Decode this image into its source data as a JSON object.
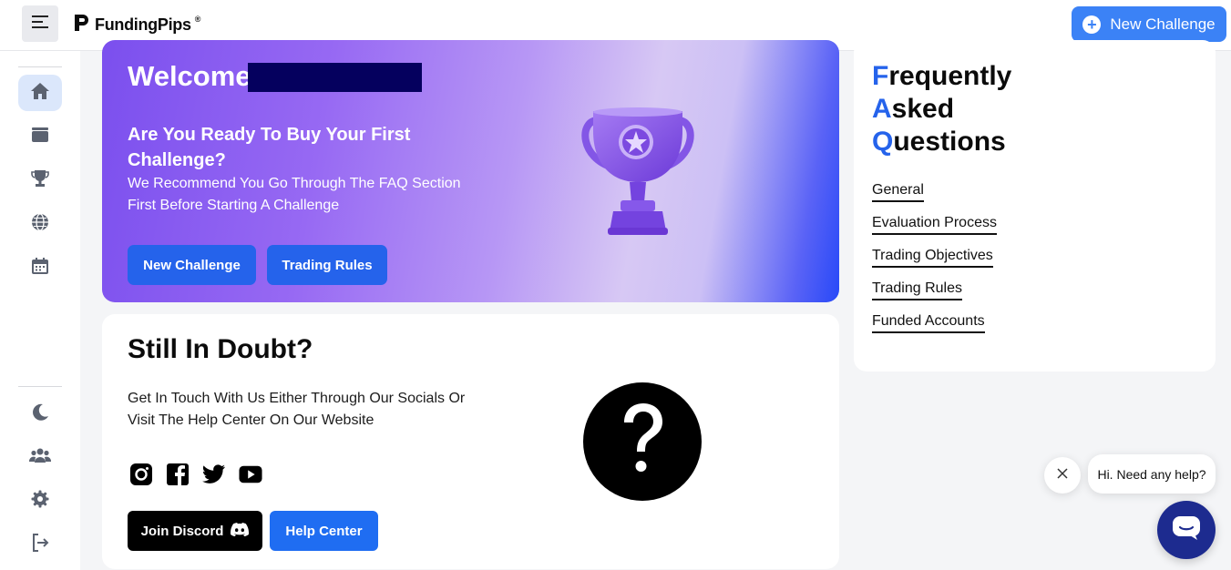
{
  "header": {
    "brand_name": "FundingPips",
    "brand_reg": "®",
    "new_challenge_label": "New Challenge"
  },
  "sidebar": {
    "items": [
      {
        "icon": "home-icon",
        "active": true
      },
      {
        "icon": "wallet-icon"
      },
      {
        "icon": "trophy-icon"
      },
      {
        "icon": "globe-icon"
      },
      {
        "icon": "calendar-icon"
      }
    ],
    "bottom_items": [
      {
        "icon": "moon-icon"
      },
      {
        "icon": "users-icon"
      },
      {
        "icon": "gear-icon"
      },
      {
        "icon": "logout-icon"
      }
    ]
  },
  "hero": {
    "welcome": "Welcome",
    "heading": "Are You Ready To Buy Your First Challenge?",
    "description": "We Recommend You Go Through The FAQ Section First Before Starting A Challenge",
    "new_challenge_label": "New Challenge",
    "trading_rules_label": "Trading Rules"
  },
  "doubt": {
    "heading": "Still In Doubt?",
    "description": "Get In Touch With Us Either Through Our Socials Or Visit The Help Center On Our Website",
    "socials": [
      "instagram-icon",
      "facebook-icon",
      "twitter-icon",
      "youtube-icon"
    ],
    "join_discord_label": "Join Discord",
    "help_center_label": "Help Center"
  },
  "faq": {
    "title": {
      "line1_first": "F",
      "line1_rest": "requently",
      "line2_first": "A",
      "line2_rest": "sked",
      "line3_first": "Q",
      "line3_rest": "uestions"
    },
    "links": [
      "General",
      "Evaluation Process",
      "Trading Objectives",
      "Trading Rules",
      "Funded Accounts"
    ]
  },
  "chat": {
    "bubble_text": "Hi. Need any help?"
  },
  "colors": {
    "accent": "#2563eb",
    "cta": "#3b82f6",
    "chat_launcher": "#1d2b8f"
  }
}
